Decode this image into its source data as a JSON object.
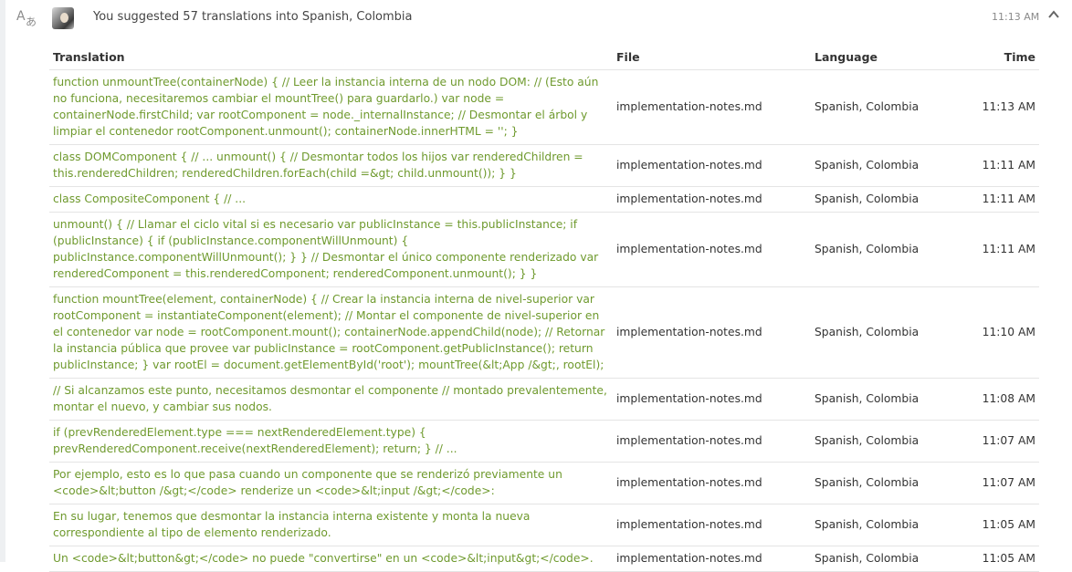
{
  "header": {
    "headline": "You suggested 57 translations into Spanish, Colombia",
    "time": "11:13 AM"
  },
  "icons": {
    "translate": "translate-icon",
    "avatar": "user-avatar",
    "collapse": "chevron-up-icon"
  },
  "colors": {
    "translation_text": "#6f9a2e",
    "rail": "#eef0f2"
  },
  "table": {
    "columns": {
      "translation": "Translation",
      "file": "File",
      "language": "Language",
      "time": "Time"
    },
    "rows": [
      {
        "translation": "function unmountTree(containerNode) { // Leer la instancia interna de un nodo DOM: // (Esto aún no funciona, necesitaremos cambiar el mountTree() para guardarlo.) var node = containerNode.firstChild; var rootComponent = node._internalInstance; // Desmontar el árbol y limpiar el contenedor rootComponent.unmount(); containerNode.innerHTML = ''; }",
        "file": "implementation-notes.md",
        "language": "Spanish, Colombia",
        "time": "11:13 AM"
      },
      {
        "translation": "class DOMComponent { // ... unmount() { // Desmontar todos los hijos var renderedChildren = this.renderedChildren; renderedChildren.forEach(child =&gt; child.unmount()); } }",
        "file": "implementation-notes.md",
        "language": "Spanish, Colombia",
        "time": "11:11 AM"
      },
      {
        "translation": "class CompositeComponent { // ...",
        "file": "implementation-notes.md",
        "language": "Spanish, Colombia",
        "time": "11:11 AM"
      },
      {
        "translation": "unmount() { // Llamar el ciclo vital si es necesario var publicInstance = this.publicInstance; if (publicInstance) { if (publicInstance.componentWillUnmount) { publicInstance.componentWillUnmount(); } } // Desmontar el único componente renderizado var renderedComponent = this.renderedComponent; renderedComponent.unmount(); } }",
        "file": "implementation-notes.md",
        "language": "Spanish, Colombia",
        "time": "11:11 AM"
      },
      {
        "translation": "function mountTree(element, containerNode) { // Crear la instancia interna de nivel-superior var rootComponent = instantiateComponent(element); // Montar el componente de nivel-superior en el contenedor var node = rootComponent.mount(); containerNode.appendChild(node); // Retornar la instancia pública que provee var publicInstance = rootComponent.getPublicInstance(); return publicInstance; } var rootEl = document.getElementById('root'); mountTree(&lt;App /&gt;, rootEl);",
        "file": "implementation-notes.md",
        "language": "Spanish, Colombia",
        "time": "11:10 AM"
      },
      {
        "translation": "// Si alcanzamos este punto, necesitamos desmontar el componente // montado prevalentemente, montar el nuevo, y cambiar sus nodos.",
        "file": "implementation-notes.md",
        "language": "Spanish, Colombia",
        "time": "11:08 AM"
      },
      {
        "translation": "if (prevRenderedElement.type === nextRenderedElement.type) { prevRenderedComponent.receive(nextRenderedElement); return; } // ...",
        "file": "implementation-notes.md",
        "language": "Spanish, Colombia",
        "time": "11:07 AM"
      },
      {
        "translation": "Por ejemplo, esto es lo que pasa cuando un componente que se renderizó previamente un <code>&lt;button /&gt;</code> renderize un <code>&lt;input /&gt;</code>:",
        "file": "implementation-notes.md",
        "language": "Spanish, Colombia",
        "time": "11:07 AM"
      },
      {
        "translation": "En su lugar, tenemos que desmontar la instancia interna existente y monta la nueva correspondiente al tipo de elemento renderizado.",
        "file": "implementation-notes.md",
        "language": "Spanish, Colombia",
        "time": "11:05 AM"
      },
      {
        "translation": "Un <code>&lt;button&gt;</code> no puede \"convertirse\" en un <code>&lt;input&gt;</code>.",
        "file": "implementation-notes.md",
        "language": "Spanish, Colombia",
        "time": "11:05 AM"
      }
    ]
  }
}
